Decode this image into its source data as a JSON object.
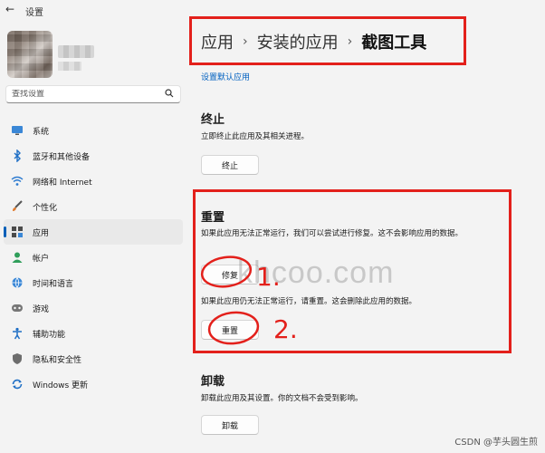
{
  "window": {
    "title": "设置"
  },
  "search": {
    "placeholder": "查找设置"
  },
  "sidebar": {
    "items": [
      {
        "label": "系统",
        "icon": "monitor-icon"
      },
      {
        "label": "蓝牙和其他设备",
        "icon": "bluetooth-icon"
      },
      {
        "label": "网络和 Internet",
        "icon": "wifi-icon"
      },
      {
        "label": "个性化",
        "icon": "brush-icon"
      },
      {
        "label": "应用",
        "icon": "apps-icon",
        "active": true
      },
      {
        "label": "帐户",
        "icon": "person-icon"
      },
      {
        "label": "时间和语言",
        "icon": "globe-clock-icon"
      },
      {
        "label": "游戏",
        "icon": "gamepad-icon"
      },
      {
        "label": "辅助功能",
        "icon": "accessibility-icon"
      },
      {
        "label": "隐私和安全性",
        "icon": "shield-icon"
      },
      {
        "label": "Windows 更新",
        "icon": "update-icon"
      }
    ]
  },
  "breadcrumb": {
    "level1": "应用",
    "level2": "安装的应用",
    "current": "截图工具",
    "separator": "›"
  },
  "main": {
    "default_apps_link": "设置默认应用",
    "terminate": {
      "title": "终止",
      "description": "立即终止此应用及其相关进程。",
      "button": "终止"
    },
    "reset": {
      "title": "重置",
      "repair_description": "如果此应用无法正常运行，我们可以尝试进行修复。这不会影响应用的数据。",
      "repair_button": "修复",
      "reset_description": "如果此应用仍无法正常运行，请重置。这会删除此应用的数据。",
      "reset_button": "重置"
    },
    "uninstall": {
      "title": "卸载",
      "description": "卸载此应用及其设置。你的文档不会受到影响。",
      "button": "卸载"
    }
  },
  "annotations": {
    "step1": "1.",
    "step2": "2.",
    "highlight_color": "#e3201b"
  },
  "watermarks": {
    "center": "khcoo.com",
    "footer": "CSDN @芋头圆生煎"
  },
  "colors": {
    "accent": "#005fb8",
    "link": "#0060c0"
  }
}
